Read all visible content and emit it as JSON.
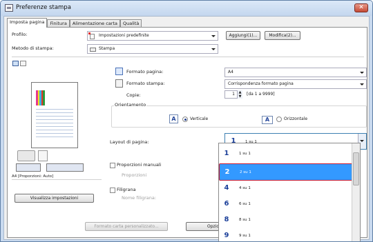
{
  "window": {
    "title": "Preferenze stampa"
  },
  "tabs": [
    {
      "label": "Imposta pagina",
      "active": true
    },
    {
      "label": "Finitura"
    },
    {
      "label": "Alimentazione carta"
    },
    {
      "label": "Qualità"
    }
  ],
  "profile": {
    "label": "Profilo:",
    "value": "Impostazioni predefinite",
    "add_label": "Aggiungi(1)...",
    "edit_label": "Modifica(2)..."
  },
  "method": {
    "label": "Metodo di stampa:",
    "value": "Stampa"
  },
  "page_size": {
    "label": "Formato pagina:",
    "value": "A4"
  },
  "output_size": {
    "label": "Formato stampa:",
    "value": "Corrispondenza formato pagina"
  },
  "copies": {
    "label": "Copie:",
    "value": "1",
    "range": "[da 1 a 9999]"
  },
  "orientation": {
    "label": "Orientamento",
    "portrait": "Verticale",
    "landscape": "Orizzontale",
    "selected": "Verticale"
  },
  "layout": {
    "label": "Layout di pagina:",
    "value": "1 su 1",
    "icon_number": "1"
  },
  "manual_scaling": {
    "label": "Proporzioni manuali",
    "sub_label": "Proporzioni"
  },
  "watermark": {
    "label": "Filigrana",
    "sub_label": "Nome filigrana:"
  },
  "preview": {
    "caption": "A4 [Proporzioni: Auto]",
    "bar_colors": [
      "#e63a8f",
      "#f0e020",
      "#38b4e6",
      "#e8322c",
      "#2a9c3b"
    ]
  },
  "view_settings_label": "Visualizza impostazioni",
  "custom_paper_label": "Formato carta personalizzato...",
  "options_label": "Opzioni",
  "layout_options": [
    {
      "number": "1",
      "label": "1 su 1"
    },
    {
      "number": "2",
      "label": "2 su 1",
      "selected": true
    },
    {
      "number": "4",
      "label": "4 su 1"
    },
    {
      "number": "6",
      "label": "6 su 1"
    },
    {
      "number": "8",
      "label": "8 su 1"
    },
    {
      "number": "9",
      "label": "9 su 1"
    }
  ]
}
